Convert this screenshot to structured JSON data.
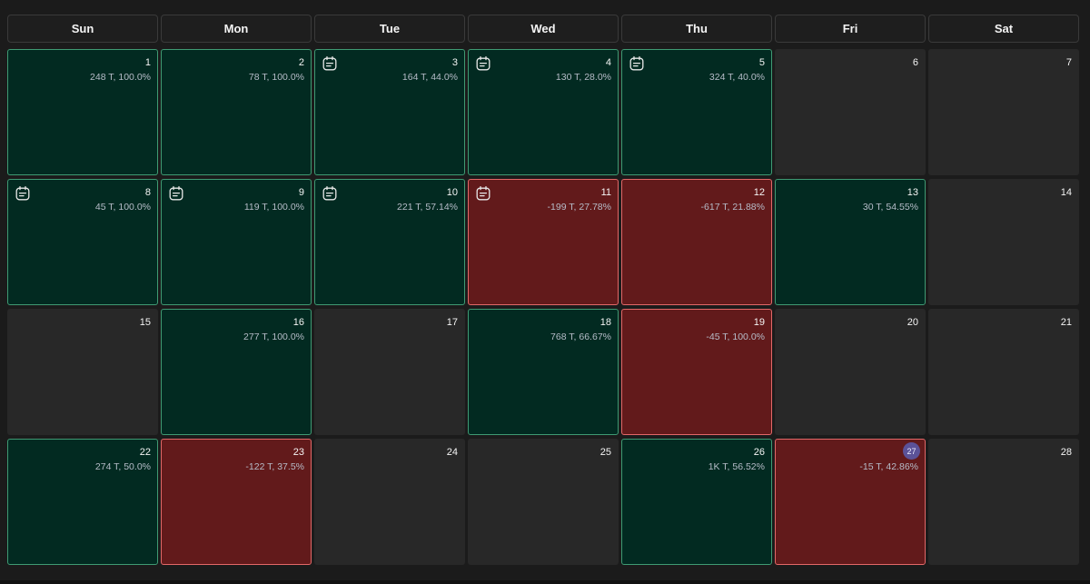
{
  "weekdays": [
    "Sun",
    "Mon",
    "Tue",
    "Wed",
    "Thu",
    "Fri",
    "Sat"
  ],
  "colors": {
    "profit_bg": "#022a21",
    "profit_border": "#3f9a73",
    "loss_bg": "#621a1b",
    "loss_border": "#e26868",
    "empty_bg": "#282828",
    "today_badge": "#5b5298"
  },
  "days": [
    {
      "day": "1",
      "status": "profit",
      "stats": "248 T, 100.0%",
      "note": false
    },
    {
      "day": "2",
      "status": "profit",
      "stats": "78 T, 100.0%",
      "note": false
    },
    {
      "day": "3",
      "status": "profit",
      "stats": "164 T, 44.0%",
      "note": true
    },
    {
      "day": "4",
      "status": "profit",
      "stats": "130 T, 28.0%",
      "note": true
    },
    {
      "day": "5",
      "status": "profit",
      "stats": "324 T, 40.0%",
      "note": true
    },
    {
      "day": "6",
      "status": "empty",
      "stats": "",
      "note": false
    },
    {
      "day": "7",
      "status": "empty",
      "stats": "",
      "note": false
    },
    {
      "day": "8",
      "status": "profit",
      "stats": "45 T, 100.0%",
      "note": true
    },
    {
      "day": "9",
      "status": "profit",
      "stats": "119 T, 100.0%",
      "note": true
    },
    {
      "day": "10",
      "status": "profit",
      "stats": "221 T, 57.14%",
      "note": true
    },
    {
      "day": "11",
      "status": "loss",
      "stats": "-199 T, 27.78%",
      "note": true
    },
    {
      "day": "12",
      "status": "loss",
      "stats": "-617 T, 21.88%",
      "note": false
    },
    {
      "day": "13",
      "status": "profit",
      "stats": "30 T, 54.55%",
      "note": false
    },
    {
      "day": "14",
      "status": "empty",
      "stats": "",
      "note": false
    },
    {
      "day": "15",
      "status": "empty",
      "stats": "",
      "note": false
    },
    {
      "day": "16",
      "status": "profit",
      "stats": "277 T, 100.0%",
      "note": false
    },
    {
      "day": "17",
      "status": "empty",
      "stats": "",
      "note": false
    },
    {
      "day": "18",
      "status": "profit",
      "stats": "768 T, 66.67%",
      "note": false
    },
    {
      "day": "19",
      "status": "loss",
      "stats": "-45 T, 100.0%",
      "note": false
    },
    {
      "day": "20",
      "status": "empty",
      "stats": "",
      "note": false
    },
    {
      "day": "21",
      "status": "empty",
      "stats": "",
      "note": false
    },
    {
      "day": "22",
      "status": "profit",
      "stats": "274 T, 50.0%",
      "note": false
    },
    {
      "day": "23",
      "status": "loss",
      "stats": "-122 T, 37.5%",
      "note": false
    },
    {
      "day": "24",
      "status": "empty",
      "stats": "",
      "note": false
    },
    {
      "day": "25",
      "status": "empty",
      "stats": "",
      "note": false
    },
    {
      "day": "26",
      "status": "profit",
      "stats": "1K T, 56.52%",
      "note": false
    },
    {
      "day": "27",
      "status": "loss",
      "stats": "-15 T, 42.86%",
      "note": false,
      "today": true
    },
    {
      "day": "28",
      "status": "empty",
      "stats": "",
      "note": false
    }
  ]
}
